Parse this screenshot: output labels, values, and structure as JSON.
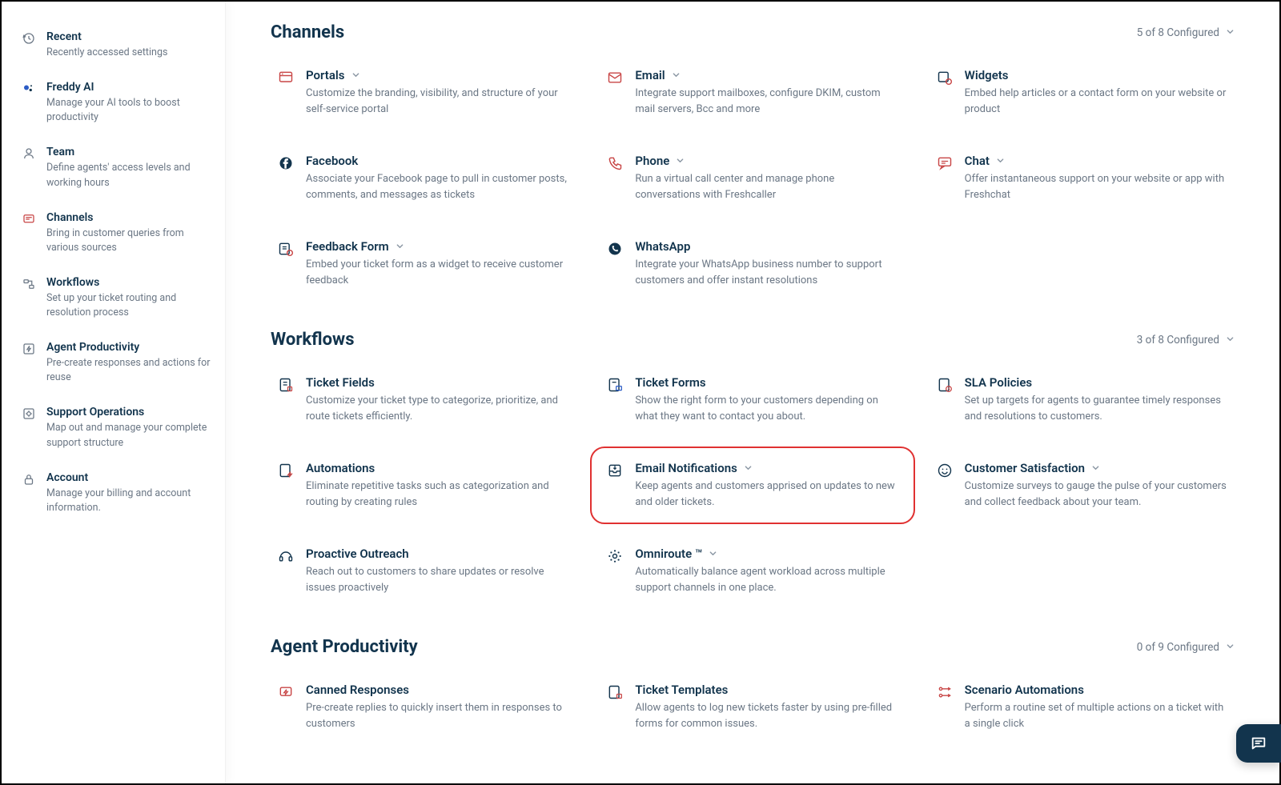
{
  "sidebar": [
    {
      "title": "Recent",
      "desc": "Recently accessed settings",
      "icon": "clock-back"
    },
    {
      "title": "Freddy AI",
      "desc": "Manage your AI tools to boost productivity",
      "icon": "ai-sparkle"
    },
    {
      "title": "Team",
      "desc": "Define agents' access levels and working hours",
      "icon": "user"
    },
    {
      "title": "Channels",
      "desc": "Bring in customer queries from various sources",
      "icon": "channel"
    },
    {
      "title": "Workflows",
      "desc": "Set up your ticket routing and resolution process",
      "icon": "workflow"
    },
    {
      "title": "Agent Productivity",
      "desc": "Pre-create responses and actions for reuse",
      "icon": "bolt-box"
    },
    {
      "title": "Support Operations",
      "desc": "Map out and manage your complete support structure",
      "icon": "ops"
    },
    {
      "title": "Account",
      "desc": "Manage your billing and account information.",
      "icon": "lock"
    }
  ],
  "sections": [
    {
      "title": "Channels",
      "status": "5 of 8 Configured",
      "cards": [
        {
          "title": "Portals",
          "desc": "Customize the branding, visibility, and structure of your self-service portal",
          "icon": "portal",
          "chevron": true
        },
        {
          "title": "Email",
          "desc": "Integrate support mailboxes, configure DKIM, custom mail servers, Bcc and more",
          "icon": "mail",
          "chevron": true
        },
        {
          "title": "Widgets",
          "desc": "Embed help articles or a contact form on your website or product",
          "icon": "widget",
          "chevron": false
        },
        {
          "title": "Facebook",
          "desc": "Associate your Facebook page to pull in customer posts, comments, and messages as tickets",
          "icon": "facebook",
          "chevron": false
        },
        {
          "title": "Phone",
          "desc": "Run a virtual call center and manage phone conversations with Freshcaller",
          "icon": "phone",
          "chevron": true
        },
        {
          "title": "Chat",
          "desc": "Offer instantaneous support on your website or app with Freshchat",
          "icon": "chat",
          "chevron": true
        },
        {
          "title": "Feedback Form",
          "desc": "Embed your ticket form as a widget to receive customer feedback",
          "icon": "feedback",
          "chevron": true
        },
        {
          "title": "WhatsApp",
          "desc": "Integrate your WhatsApp business number to support customers and offer instant resolutions",
          "icon": "whatsapp",
          "chevron": false
        }
      ]
    },
    {
      "title": "Workflows",
      "status": "3 of 8 Configured",
      "cards": [
        {
          "title": "Ticket Fields",
          "desc": "Customize your ticket type to categorize, prioritize, and route tickets efficiently.",
          "icon": "fields",
          "chevron": false
        },
        {
          "title": "Ticket Forms",
          "desc": "Show the right form to your customers depending on what they want to contact you about.",
          "icon": "forms",
          "chevron": false
        },
        {
          "title": "SLA Policies",
          "desc": "Set up targets for agents to guarantee timely responses and resolutions to customers.",
          "icon": "sla",
          "chevron": false
        },
        {
          "title": "Automations",
          "desc": "Eliminate repetitive tasks such as categorization and routing by creating rules",
          "icon": "auto",
          "chevron": false
        },
        {
          "title": "Email Notifications",
          "desc": "Keep agents and customers apprised on updates to new and older tickets.",
          "icon": "inbox",
          "chevron": true,
          "highlighted": true
        },
        {
          "title": "Customer Satisfaction",
          "desc": "Customize surveys to gauge the pulse of your customers and collect feedback about your team.",
          "icon": "smile",
          "chevron": true
        },
        {
          "title": "Proactive Outreach",
          "desc": "Reach out to customers to share updates or resolve issues proactively",
          "icon": "outreach",
          "chevron": false
        },
        {
          "title": "Omniroute ™",
          "desc": "Automatically balance agent workload across multiple support channels in one place.",
          "icon": "omni",
          "chevron": true
        }
      ]
    },
    {
      "title": "Agent Productivity",
      "status": "0 of 9 Configured",
      "cards": [
        {
          "title": "Canned Responses",
          "desc": "Pre-create replies to quickly insert them in responses to customers",
          "icon": "canned",
          "chevron": false
        },
        {
          "title": "Ticket Templates",
          "desc": "Allow agents to log new tickets faster by using pre-filled forms for common issues.",
          "icon": "template",
          "chevron": false
        },
        {
          "title": "Scenario Automations",
          "desc": "Perform a routine set of multiple actions on a ticket with a single click",
          "icon": "scenario",
          "chevron": false
        }
      ]
    }
  ]
}
